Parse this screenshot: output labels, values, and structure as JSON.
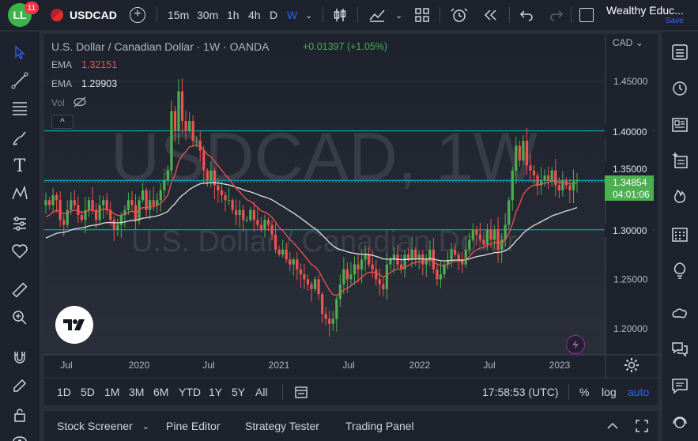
{
  "header": {
    "logo_text": "LL",
    "notification_count": "11",
    "symbol": "USDCAD",
    "timeframes": [
      "15m",
      "30m",
      "1h",
      "4h",
      "D",
      "W"
    ],
    "active_timeframe": "W",
    "layout_name": "Wealthy Educ...",
    "save_label": "Save"
  },
  "legend": {
    "title": "U.S. Dollar / Canadian Dollar · 1W · OANDA",
    "change": "+0.01397 (+1.05%)",
    "ema1_label": "EMA",
    "ema1_value": "1.32151",
    "ema2_label": "EMA",
    "ema2_value": "1.29903",
    "vol_label": "Vol",
    "collapse": "^"
  },
  "watermark": {
    "symbol": "USDCAD, 1W",
    "name": "U.S. Dollar / Canadian Dollar"
  },
  "price_axis": {
    "currency": "CAD",
    "ticks": [
      "1.45000",
      "1.40000",
      "1.35000",
      "1.30000",
      "1.25000",
      "1.20000"
    ],
    "current_price": "1.34854",
    "countdown": "04:01:06"
  },
  "time_axis": {
    "ticks": [
      "Jul",
      "2020",
      "Jul",
      "2021",
      "Jul",
      "2022",
      "Jul",
      "2023"
    ]
  },
  "bottom_bar": {
    "ranges": [
      "1D",
      "5D",
      "1M",
      "3M",
      "6M",
      "YTD",
      "1Y",
      "5Y",
      "All"
    ],
    "clock": "17:58:53 (UTC)",
    "percent": "%",
    "log": "log",
    "auto": "auto"
  },
  "panel_tabs": [
    "Stock Screener",
    "Pine Editor",
    "Strategy Tester",
    "Trading Panel"
  ],
  "colors": {
    "up": "#26a69a",
    "up_candle": "#4caf50",
    "down": "#ef5350",
    "ema_fast": "#ef5350",
    "ema_slow": "#e0e0e0",
    "hline": "#00bcd4",
    "accent": "#2962ff"
  },
  "chart_data": {
    "type": "candlestick",
    "symbol": "USDCAD",
    "interval": "1W",
    "horizontal_lines": [
      1.4,
      1.35,
      1.3
    ],
    "ylim": [
      1.18,
      1.48
    ],
    "closes": [
      1.33,
      1.325,
      1.335,
      1.33,
      1.31,
      1.305,
      1.32,
      1.33,
      1.325,
      1.315,
      1.31,
      1.32,
      1.33,
      1.32,
      1.31,
      1.325,
      1.33,
      1.32,
      1.31,
      1.3,
      1.305,
      1.315,
      1.32,
      1.33,
      1.325,
      1.31,
      1.33,
      1.34,
      1.32,
      1.33,
      1.325,
      1.33,
      1.34,
      1.35,
      1.36,
      1.42,
      1.4,
      1.44,
      1.41,
      1.4,
      1.41,
      1.39,
      1.39,
      1.38,
      1.36,
      1.35,
      1.36,
      1.345,
      1.34,
      1.335,
      1.33,
      1.33,
      1.32,
      1.315,
      1.32,
      1.31,
      1.31,
      1.32,
      1.31,
      1.305,
      1.3,
      1.31,
      1.305,
      1.295,
      1.28,
      1.275,
      1.28,
      1.27,
      1.265,
      1.27,
      1.26,
      1.255,
      1.25,
      1.245,
      1.24,
      1.25,
      1.235,
      1.215,
      1.21,
      1.205,
      1.21,
      1.23,
      1.245,
      1.26,
      1.25,
      1.255,
      1.265,
      1.26,
      1.27,
      1.275,
      1.265,
      1.26,
      1.25,
      1.245,
      1.24,
      1.265,
      1.27,
      1.275,
      1.265,
      1.26,
      1.275,
      1.27,
      1.28,
      1.27,
      1.275,
      1.265,
      1.27,
      1.28,
      1.26,
      1.25,
      1.255,
      1.265,
      1.27,
      1.28,
      1.275,
      1.27,
      1.265,
      1.28,
      1.29,
      1.3,
      1.295,
      1.29,
      1.285,
      1.3,
      1.29,
      1.3,
      1.28,
      1.29,
      1.305,
      1.33,
      1.36,
      1.385,
      1.37,
      1.39,
      1.365,
      1.36,
      1.355,
      1.345,
      1.35,
      1.355,
      1.35,
      1.36,
      1.345,
      1.34,
      1.35,
      1.345,
      1.34,
      1.35,
      1.35
    ]
  }
}
